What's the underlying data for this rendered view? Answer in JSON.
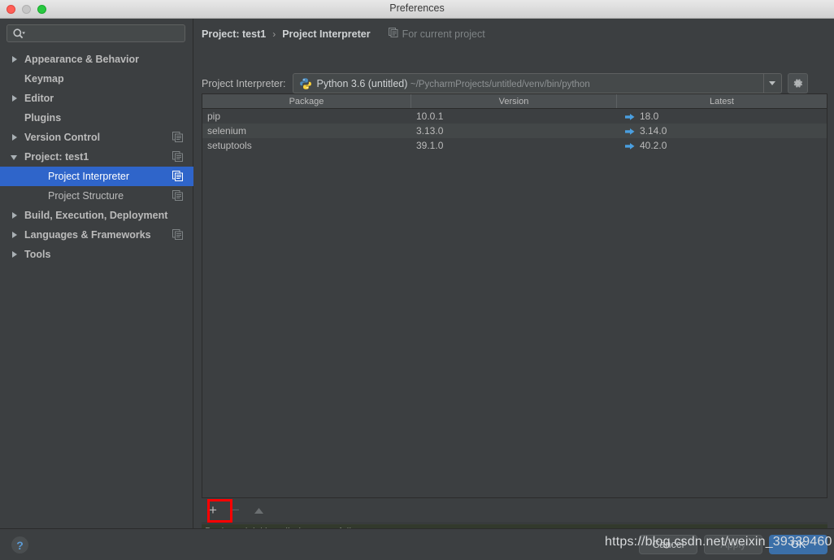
{
  "window": {
    "title": "Preferences",
    "controls": [
      "close",
      "minimize",
      "zoom"
    ]
  },
  "sidebar": {
    "search": {
      "value": "",
      "placeholder": ""
    },
    "items": [
      {
        "label": "Appearance & Behavior",
        "twisty": "right",
        "bold": true,
        "indent": false,
        "module_icon": false,
        "selected": false
      },
      {
        "label": "Keymap",
        "twisty": "none",
        "bold": true,
        "indent": false,
        "module_icon": false,
        "selected": false
      },
      {
        "label": "Editor",
        "twisty": "right",
        "bold": true,
        "indent": false,
        "module_icon": false,
        "selected": false
      },
      {
        "label": "Plugins",
        "twisty": "none",
        "bold": true,
        "indent": false,
        "module_icon": false,
        "selected": false
      },
      {
        "label": "Version Control",
        "twisty": "right",
        "bold": true,
        "indent": false,
        "module_icon": true,
        "selected": false
      },
      {
        "label": "Project: test1",
        "twisty": "down",
        "bold": true,
        "indent": false,
        "module_icon": true,
        "selected": false
      },
      {
        "label": "Project Interpreter",
        "twisty": "none",
        "bold": false,
        "indent": true,
        "module_icon": true,
        "selected": true
      },
      {
        "label": "Project Structure",
        "twisty": "none",
        "bold": false,
        "indent": true,
        "module_icon": true,
        "selected": false
      },
      {
        "label": "Build, Execution, Deployment",
        "twisty": "right",
        "bold": true,
        "indent": false,
        "module_icon": false,
        "selected": false
      },
      {
        "label": "Languages & Frameworks",
        "twisty": "right",
        "bold": true,
        "indent": false,
        "module_icon": true,
        "selected": false
      },
      {
        "label": "Tools",
        "twisty": "right",
        "bold": true,
        "indent": false,
        "module_icon": false,
        "selected": false
      }
    ]
  },
  "main": {
    "breadcrumb": {
      "parent": "Project: test1",
      "separator": "›",
      "current": "Project Interpreter",
      "scope_label": "For current project"
    },
    "interpreter": {
      "label": "Project Interpreter:",
      "name": "Python 3.6 (untitled)",
      "path": "~/PycharmProjects/untitled/venv/bin/python"
    },
    "packages_table": {
      "columns": [
        "Package",
        "Version",
        "Latest"
      ],
      "rows": [
        {
          "package": "pip",
          "version": "10.0.1",
          "latest": "18.0"
        },
        {
          "package": "selenium",
          "version": "3.13.0",
          "latest": "3.14.0"
        },
        {
          "package": "setuptools",
          "version": "39.1.0",
          "latest": "40.2.0"
        }
      ]
    },
    "toolbar": {
      "add_label": "+",
      "remove_label": "−",
      "upgrade_label": "▲"
    },
    "status_message": "Package 'pip' installed successfully"
  },
  "footer": {
    "help_label": "?",
    "cancel_label": "Cancel",
    "apply_label": "Apply",
    "ok_label": "OK"
  },
  "watermark": "https://blog.csdn.net/weixin_39339460",
  "colors": {
    "background": "#3c3f41",
    "selection": "#2f65ca",
    "accent_link": "#4a9fe0",
    "status_background": "#32392c",
    "highlight_box": "#ff0000",
    "primary_button": "#3b6fa8"
  }
}
